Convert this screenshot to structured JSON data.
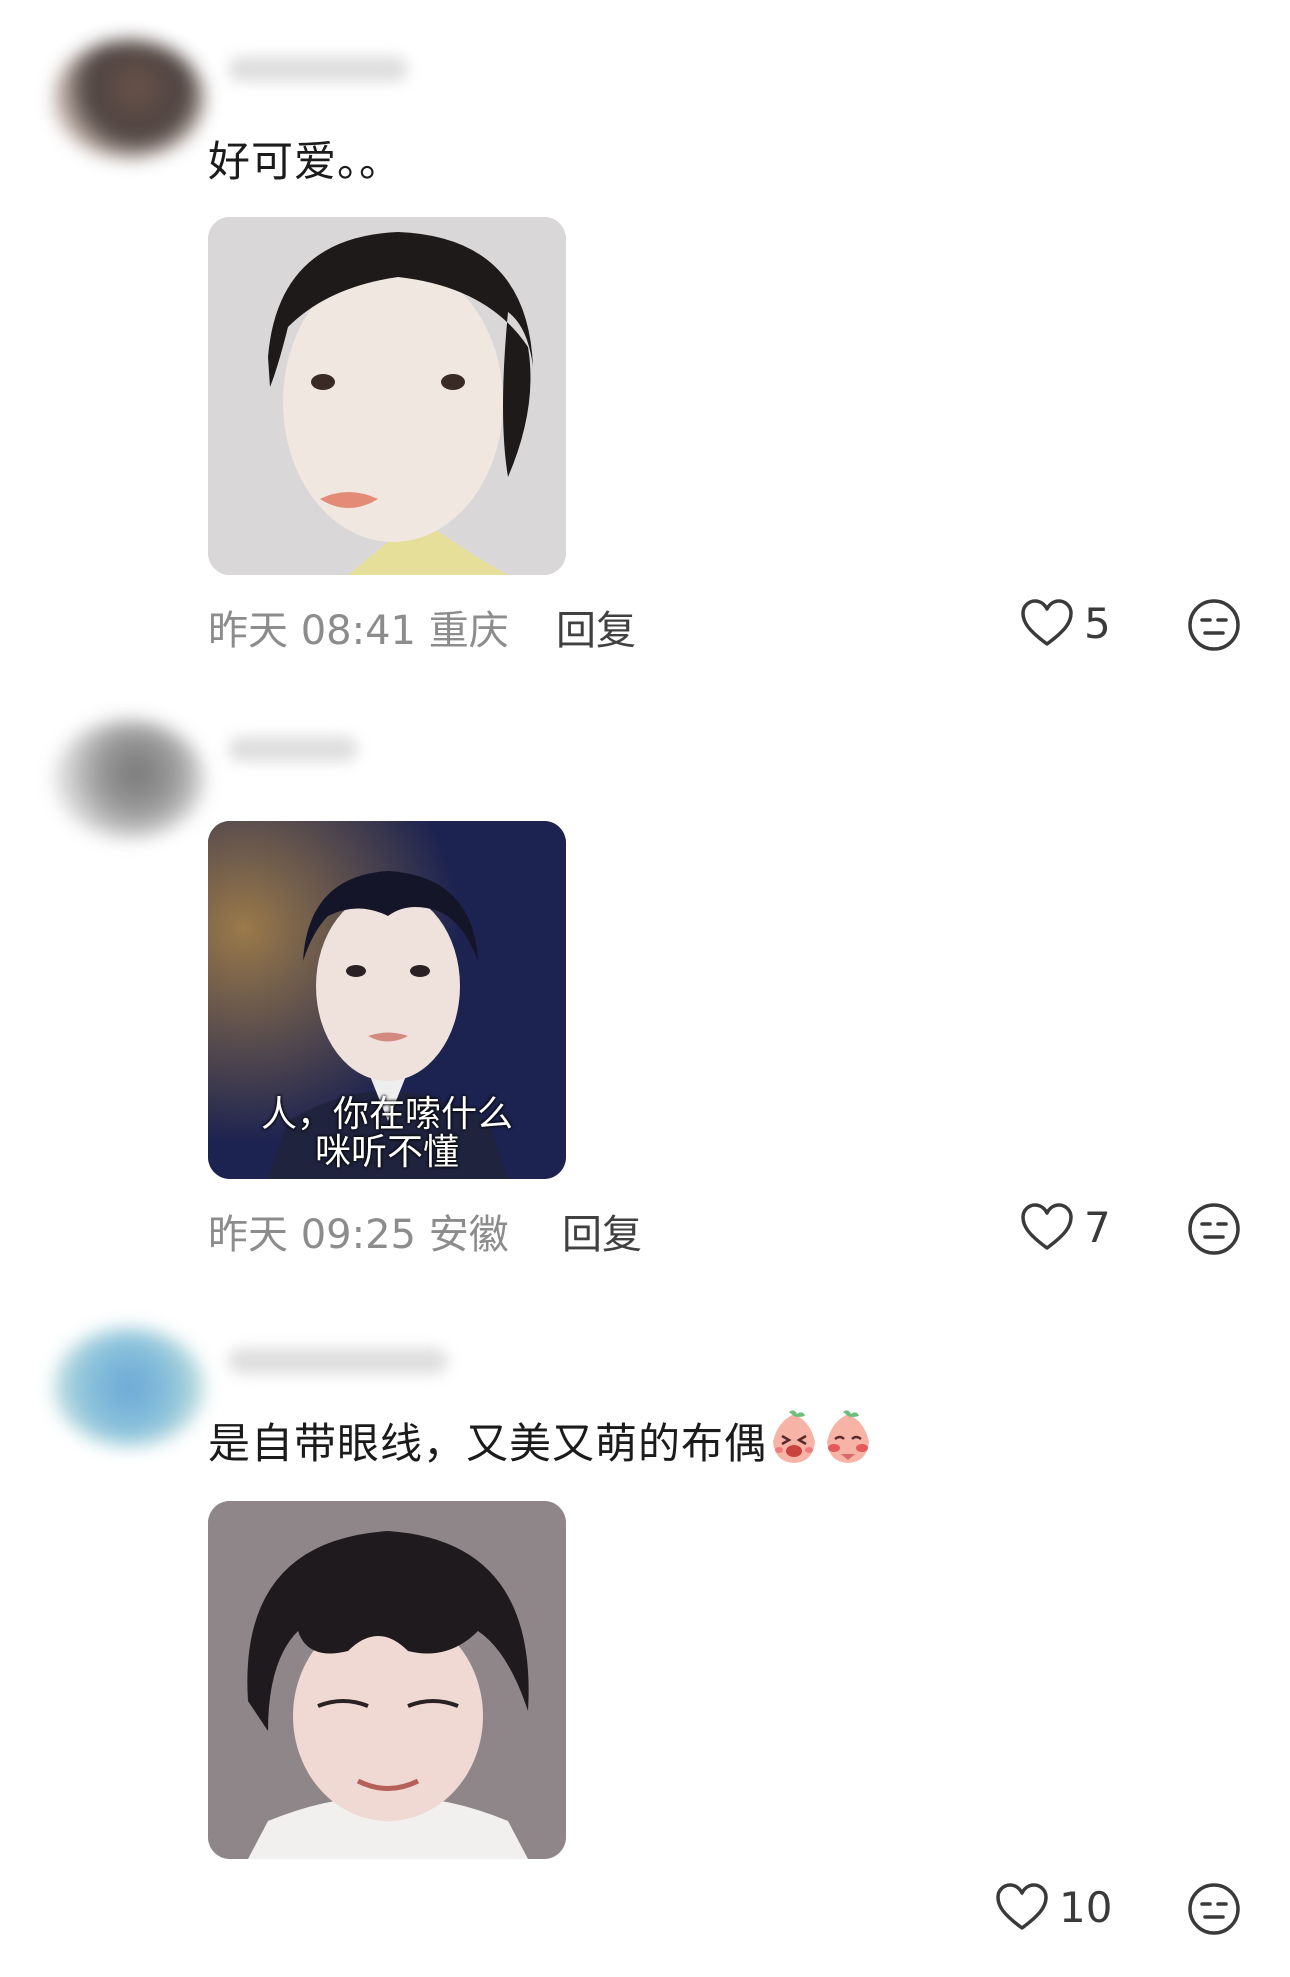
{
  "comments": [
    {
      "text": "好可爱。。",
      "time": "昨天 08:41",
      "location": "重庆",
      "reply_label": "回复",
      "likes": "5"
    },
    {
      "text": "",
      "sticker_caption_line1": "人，你在嗦什么",
      "sticker_caption_line2": "咪听不懂",
      "time": "昨天 09:25",
      "location": "安徽",
      "reply_label": "回复",
      "likes": "7"
    },
    {
      "text": "是自带眼线，又美又萌的布偶",
      "likes": "10"
    }
  ],
  "icons": {
    "like": "heart-outline-icon",
    "dislike": "neutral-face-icon",
    "emoji_1": "peach-laugh-emoji",
    "emoji_2": "peach-shy-emoji"
  },
  "colors": {
    "text": "#1b1b1b",
    "meta": "#8c8c8c",
    "icon": "#3a3a3a"
  }
}
